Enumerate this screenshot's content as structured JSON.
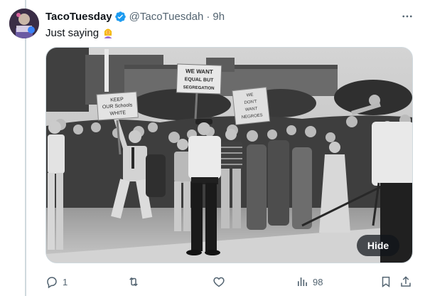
{
  "tweet": {
    "author": {
      "display_name": "TacoTuesday",
      "handle": "@TacoTuesdah",
      "verified": true,
      "avatar_icon": "avatar-image"
    },
    "time": "9h",
    "separator": "·",
    "text": "Just saying",
    "text_emoji": "woman-facepalming-emoji",
    "media": {
      "description_icon": "historical-protest-photo",
      "signs": {
        "left_line1": "KEEP",
        "left_line2": "OUR Schools",
        "left_line3": "WHITE",
        "center_line1": "WE WANT",
        "center_line2": "EQUAL BUT",
        "center_line3": "SEGREGATION",
        "right_line1": "WE",
        "right_line2": "DON'T",
        "right_line3": "WANT",
        "right_line4": "NEGROES"
      },
      "hide_label": "Hide"
    },
    "actions": {
      "replies": "1",
      "reposts": "",
      "likes": "",
      "views": "98"
    }
  },
  "colors": {
    "verified_blue": "#1d9bf0",
    "text_primary": "#0f1419",
    "text_secondary": "#536471",
    "thread_line": "#cfd9de"
  }
}
